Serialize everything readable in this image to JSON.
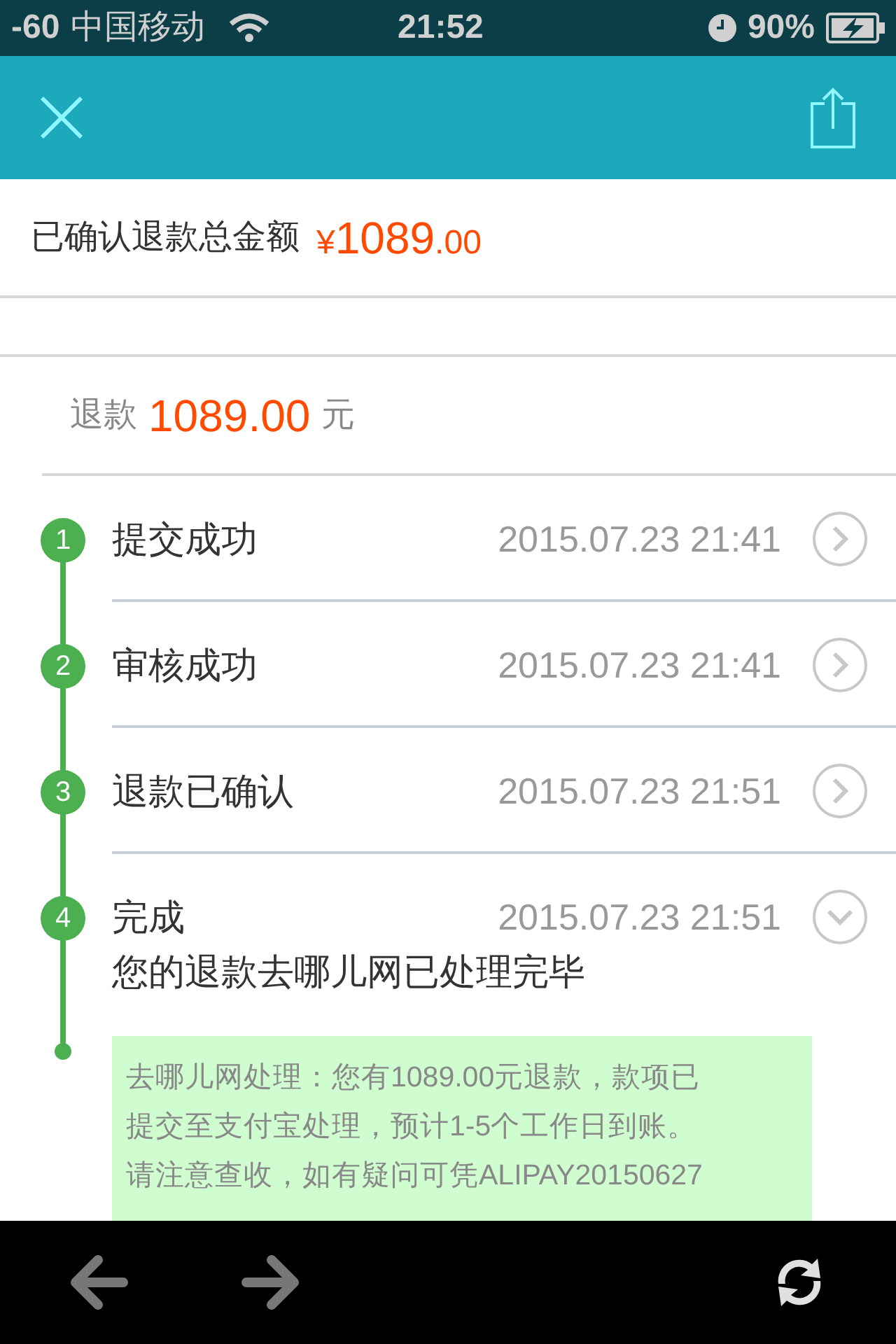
{
  "status_bar": {
    "signal": "-60",
    "carrier": "中国移动",
    "time": "21:52",
    "battery": "90%"
  },
  "summary": {
    "label": "已确认退款总金额",
    "currency": "¥",
    "amount": "1089",
    "decimals": ".00"
  },
  "refund": {
    "label": "退款",
    "amount": "1089.00",
    "unit": "元"
  },
  "steps": [
    {
      "number": "1",
      "title": "提交成功",
      "time": "2015.07.23 21:41",
      "expanded": false
    },
    {
      "number": "2",
      "title": "审核成功",
      "time": "2015.07.23 21:41",
      "expanded": false
    },
    {
      "number": "3",
      "title": "退款已确认",
      "time": "2015.07.23 21:51",
      "expanded": false
    },
    {
      "number": "4",
      "title": "完成",
      "time": "2015.07.23 21:51",
      "expanded": true,
      "subtitle": "您的退款去哪儿网已处理完毕"
    }
  ],
  "note": {
    "lines": [
      "去哪儿网处理：您有1089.00元退款，款项已",
      "提交至支付宝处理，预计1-5个工作日到账。",
      "请注意查收，如有疑问可凭ALIPAY20150627"
    ]
  }
}
